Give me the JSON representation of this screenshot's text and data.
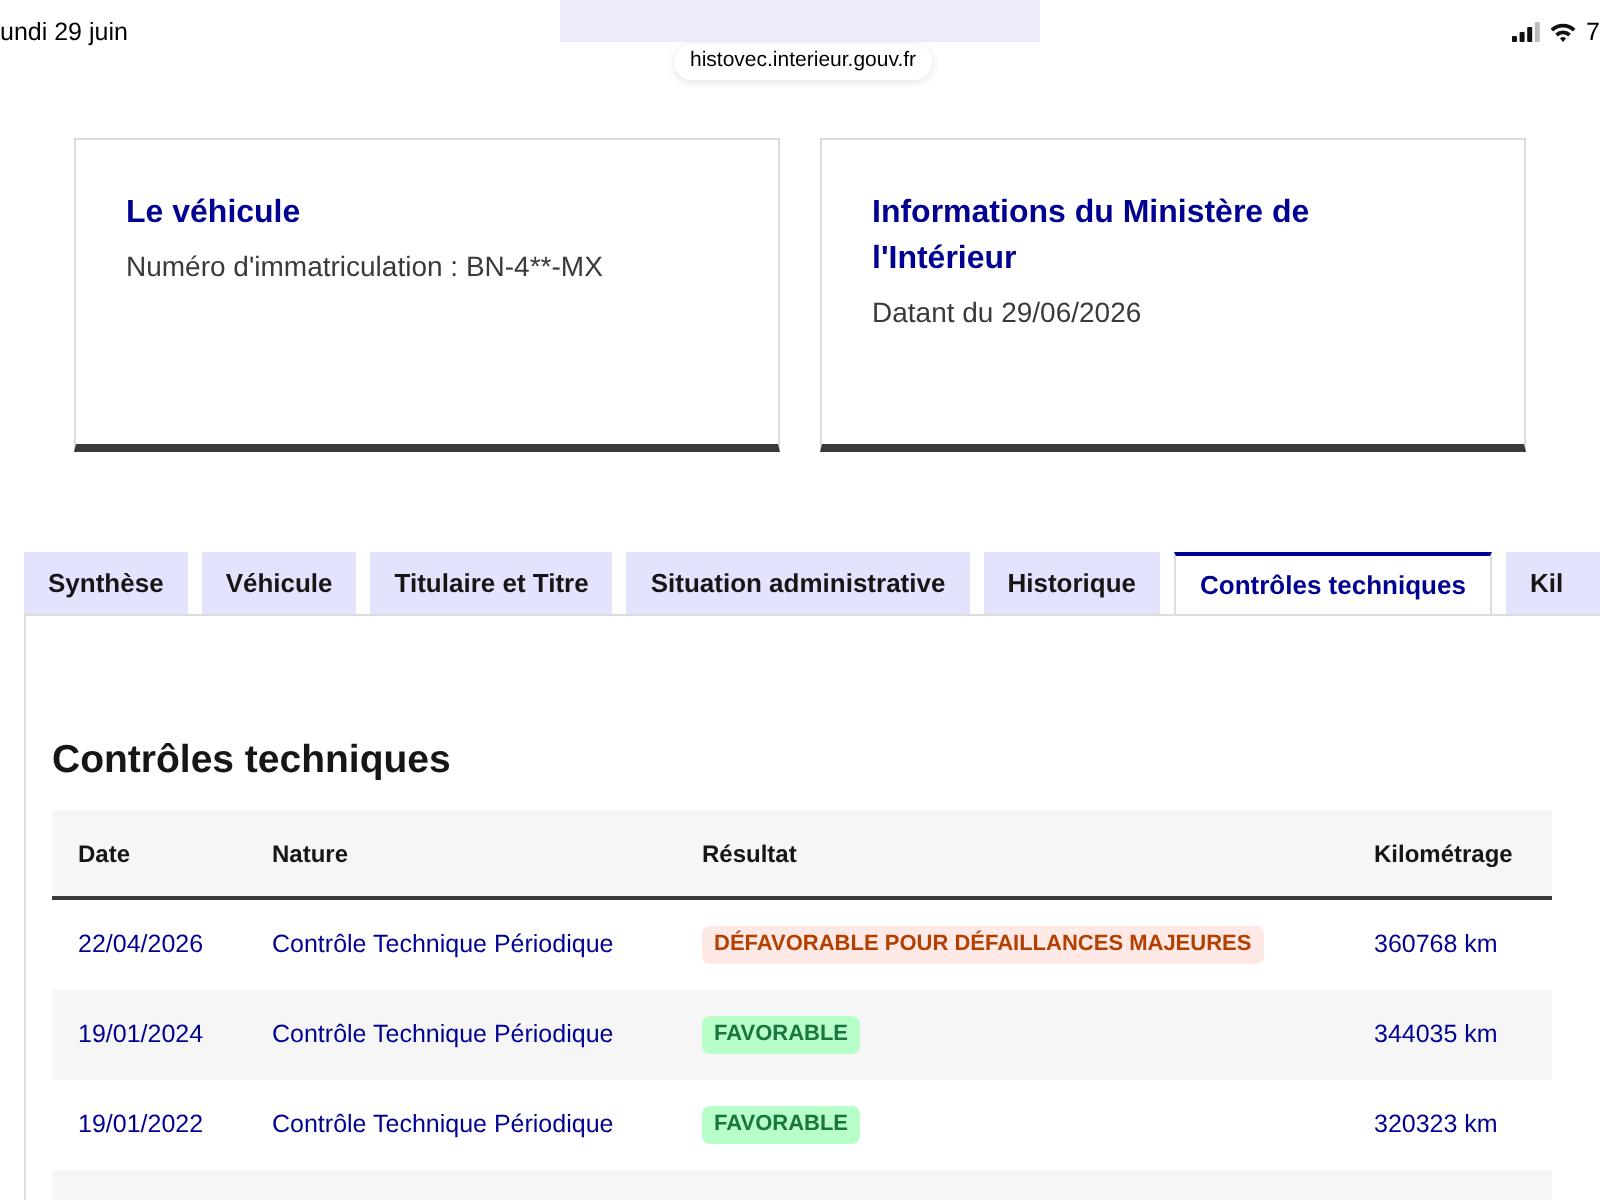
{
  "status_bar": {
    "date": "undi 29 juin",
    "battery": "7"
  },
  "address_bar": {
    "url": "histovec.interieur.gouv.fr"
  },
  "cards": [
    {
      "title": "Le véhicule",
      "text": "Numéro d'immatriculation : BN-4**-MX"
    },
    {
      "title": "Informations du Ministère de l'Intérieur",
      "text": "Datant du 29/06/2026"
    }
  ],
  "tabs": [
    {
      "label": "Synthèse",
      "selected": false
    },
    {
      "label": "Véhicule",
      "selected": false
    },
    {
      "label": "Titulaire et Titre",
      "selected": false
    },
    {
      "label": "Situation administrative",
      "selected": false
    },
    {
      "label": "Historique",
      "selected": false
    },
    {
      "label": "Contrôles techniques",
      "selected": true
    },
    {
      "label": "Kil",
      "selected": false
    }
  ],
  "section": {
    "title": "Contrôles techniques",
    "table": {
      "columns": [
        "Date",
        "Nature",
        "Résultat",
        "Kilométrage"
      ],
      "rows": [
        {
          "date": "22/04/2026",
          "nature": "Contrôle Technique Périodique",
          "result": {
            "label": "DÉFAVORABLE POUR DÉFAILLANCES MAJEURES",
            "kind": "error"
          },
          "mileage": "360768 km"
        },
        {
          "date": "19/01/2024",
          "nature": "Contrôle Technique Périodique",
          "result": {
            "label": "FAVORABLE",
            "kind": "success"
          },
          "mileage": "344035 km"
        },
        {
          "date": "19/01/2022",
          "nature": "Contrôle Technique Périodique",
          "result": {
            "label": "FAVORABLE",
            "kind": "success"
          },
          "mileage": "320323 km"
        }
      ]
    }
  }
}
